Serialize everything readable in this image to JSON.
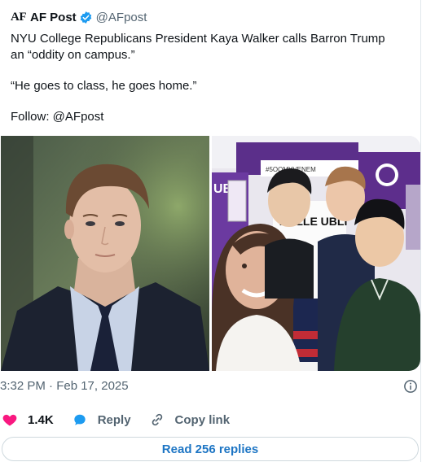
{
  "tweet": {
    "logo_text": "AF",
    "author_name": "AF Post",
    "handle": "@AFpost",
    "text_line1": "NYU College Republicans President Kaya Walker calls Barron Trump an “oddity on campus.”",
    "text_quote": "“He goes to class, he goes home.”",
    "text_follow": "Follow: @AFpost",
    "timestamp": "3:32 PM · Feb 17, 2025"
  },
  "actions": {
    "likes": "1.4K",
    "reply": "Reply",
    "copy_link": "Copy link"
  },
  "footer": {
    "read_replies": "Read 256 replies"
  },
  "media": {
    "image1_sign_text": "",
    "image2_sign_text": "#5OOMYVENEM",
    "image2_banner_text": "UB",
    "image2_table_text": "YU LLE UBLI"
  },
  "colors": {
    "verified": "#1d9bf0",
    "like": "#f91880",
    "reply": "#1d9bf0",
    "link_text": "#1d75c4"
  }
}
